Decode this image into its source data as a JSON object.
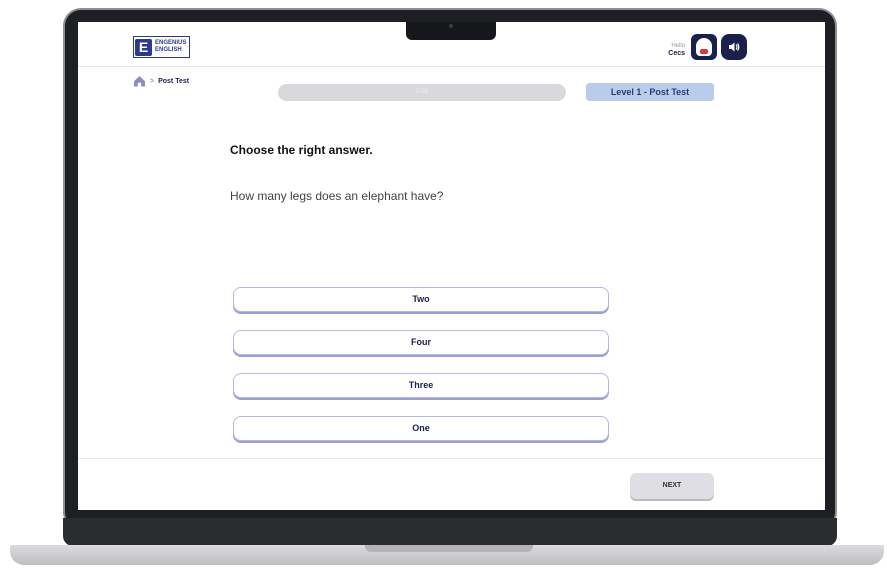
{
  "header": {
    "logo_letter": "E",
    "logo_line1": "ENGENIUS",
    "logo_line2": "ENGLISH",
    "user_greeting": "Hello",
    "user_name": "Cecs"
  },
  "breadcrumb": {
    "current": "Post Test"
  },
  "progress": {
    "label": "0/20",
    "fraction": 0.0
  },
  "level_badge": "Level 1 - Post Test",
  "question": {
    "instruction": "Choose the right answer.",
    "text": "How many legs does an elephant have?",
    "options": [
      "Two",
      "Four",
      "Three",
      "One"
    ]
  },
  "footer": {
    "next_label": "NEXT"
  },
  "colors": {
    "brand_navy": "#1b1f4b",
    "badge_blue": "#b9cdea",
    "option_border": "#b5b7e6"
  }
}
